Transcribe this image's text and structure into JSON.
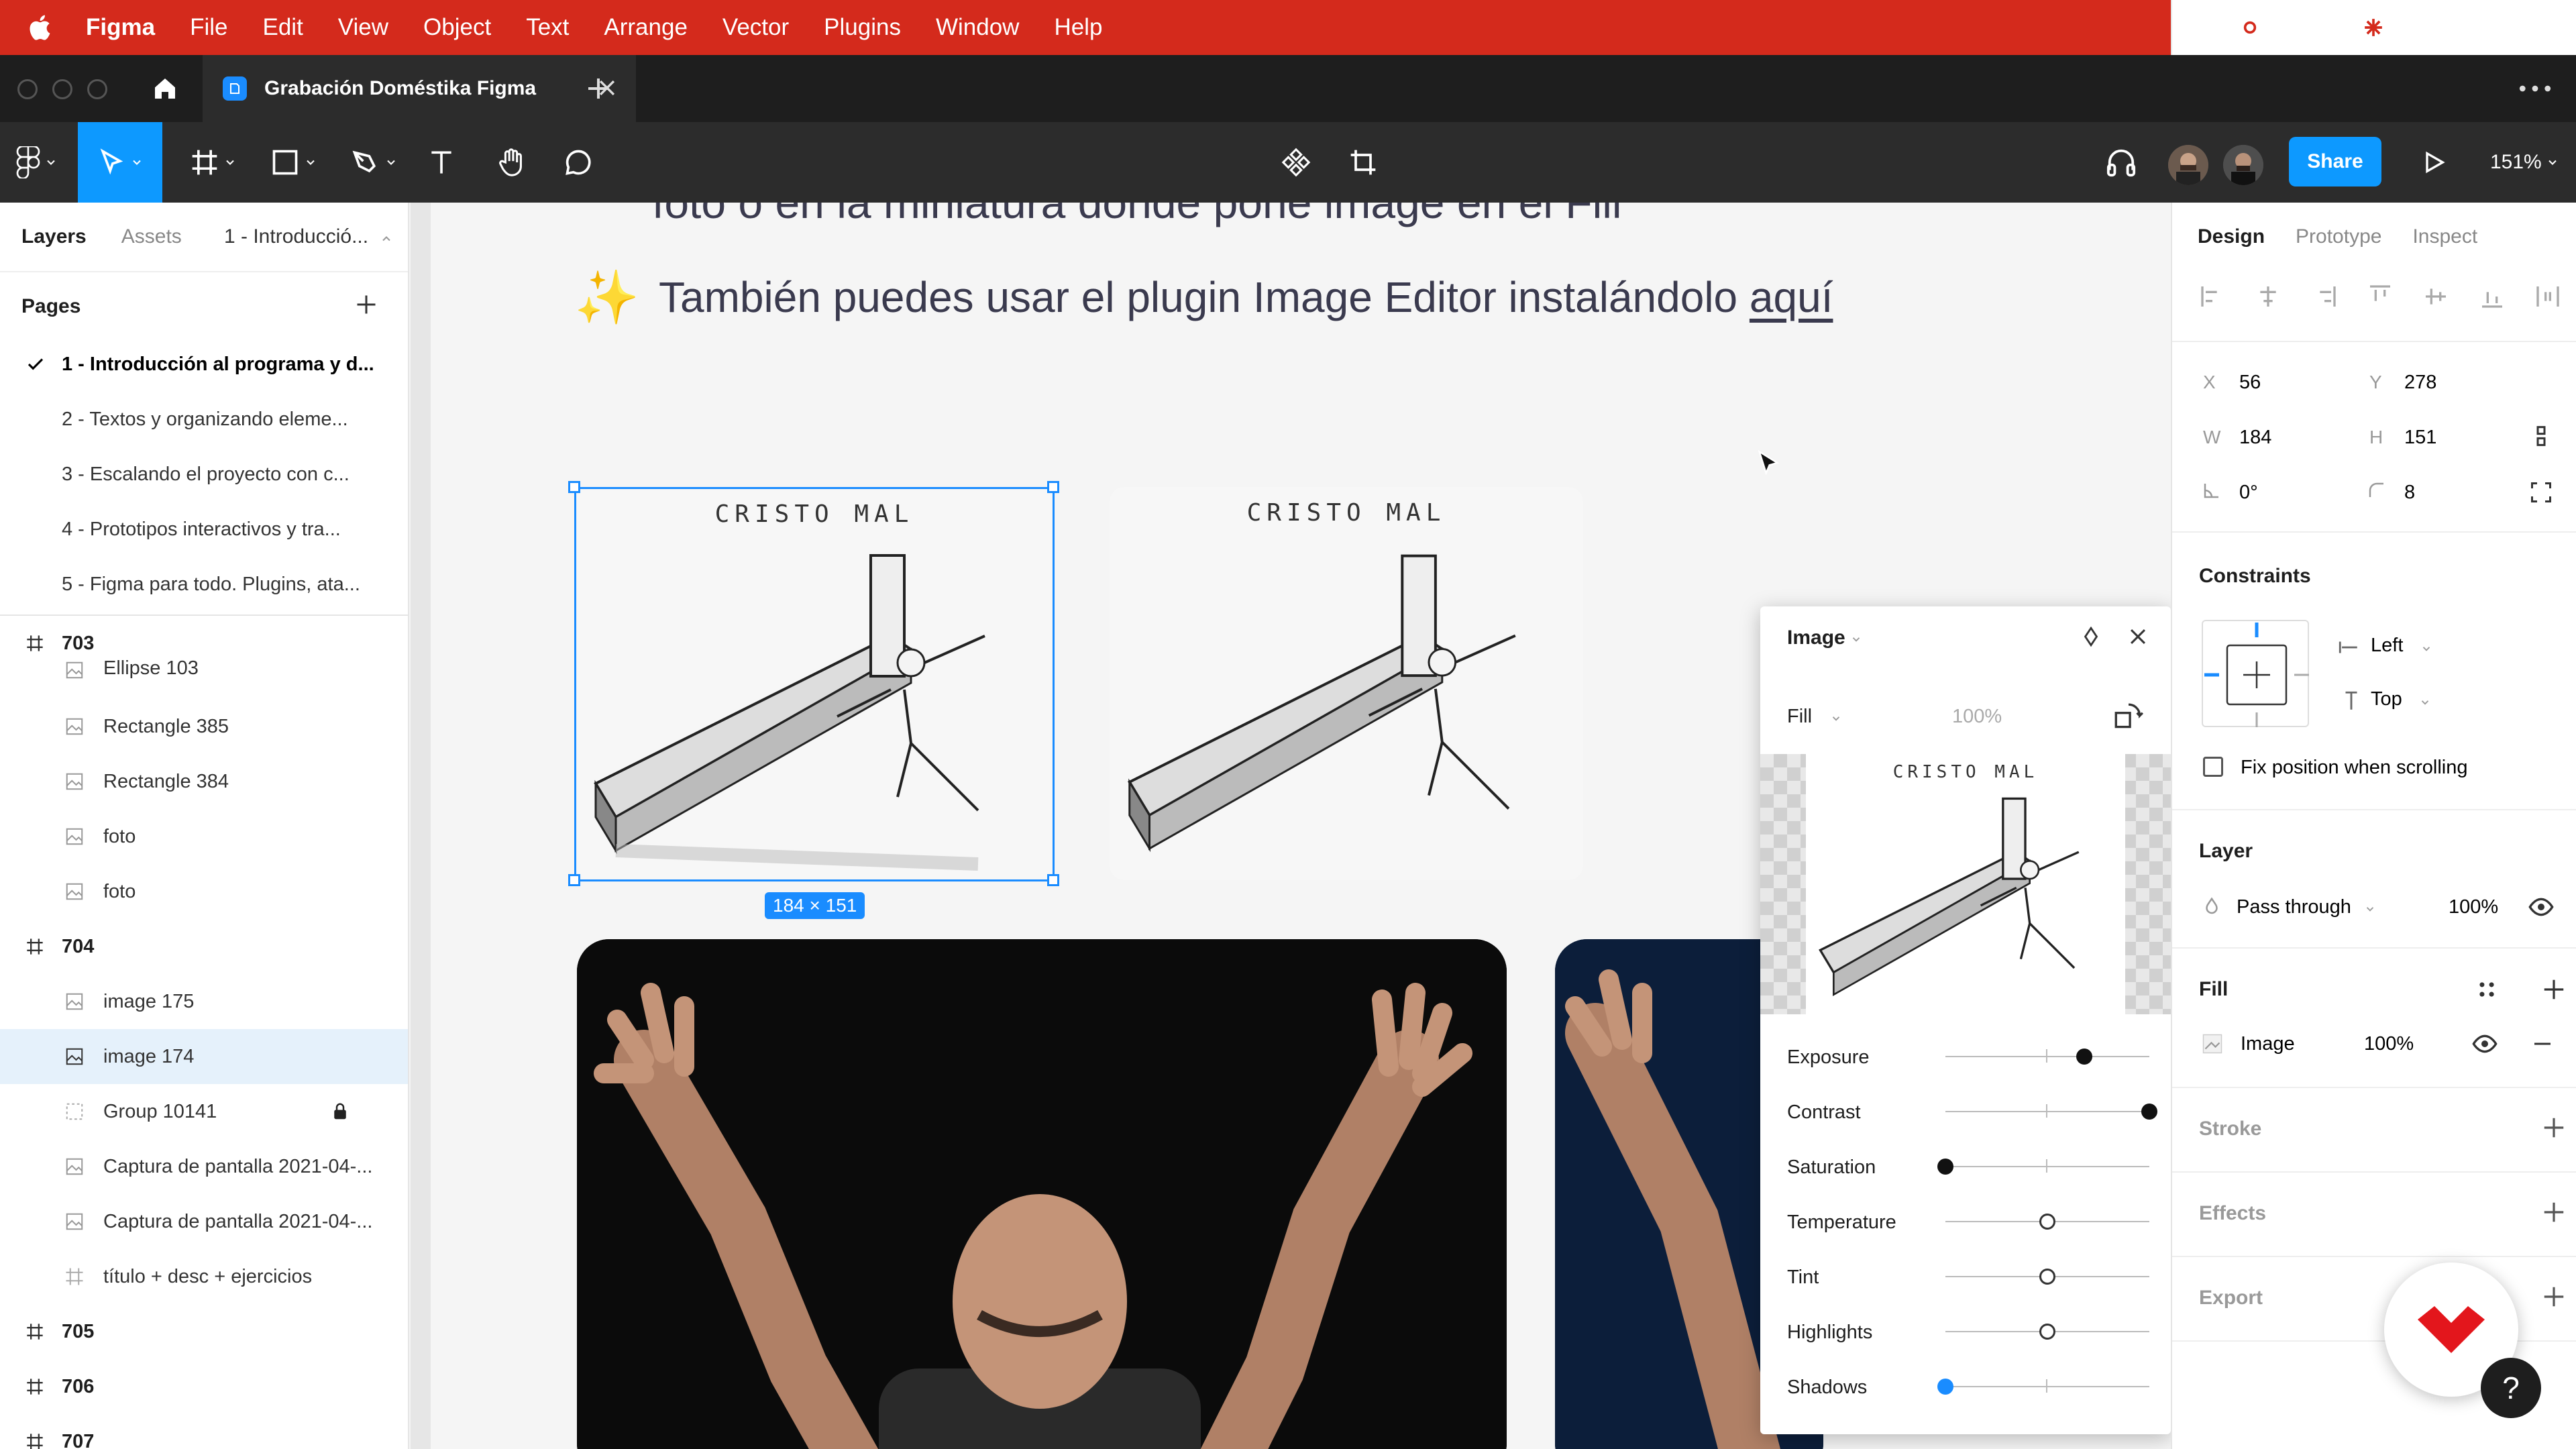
{
  "menubar": {
    "app": "Figma",
    "items": [
      "File",
      "Edit",
      "View",
      "Object",
      "Text",
      "Arrange",
      "Vector",
      "Plugins",
      "Window",
      "Help"
    ],
    "right_icons": [
      "creative-cloud-icon",
      "app-icon",
      "plus-cross-icon",
      "snowflake-icon",
      "search-icon",
      "control-center-icon",
      "clock-icon"
    ]
  },
  "tabbar": {
    "file_title": "Grabación Doméstika Figma"
  },
  "toolbar": {
    "share_label": "Share",
    "zoom": "151%"
  },
  "left": {
    "tab_layers": "Layers",
    "tab_assets": "Assets",
    "page_selector": "1 - Introducció...",
    "pages_heading": "Pages",
    "pages": [
      {
        "label": "1 - Introducción al programa y d...",
        "current": true
      },
      {
        "label": "2 - Textos y organizando eleme...",
        "current": false
      },
      {
        "label": "3 - Escalando el proyecto con c...",
        "current": false
      },
      {
        "label": "4 - Prototipos interactivos y tra...",
        "current": false
      },
      {
        "label": "5 - Figma para todo. Plugins, ata...",
        "current": false
      }
    ],
    "layers": [
      {
        "label": "703",
        "kind": "frame"
      },
      {
        "label": "Ellipse 103",
        "kind": "image"
      },
      {
        "label": "Rectangle 385",
        "kind": "image"
      },
      {
        "label": "Rectangle 384",
        "kind": "image"
      },
      {
        "label": "foto",
        "kind": "image"
      },
      {
        "label": "foto",
        "kind": "image"
      },
      {
        "label": "704",
        "kind": "frame"
      },
      {
        "label": "image 175",
        "kind": "image"
      },
      {
        "label": "image 174",
        "kind": "image",
        "selected": true
      },
      {
        "label": "Group 10141",
        "kind": "group",
        "locked": true
      },
      {
        "label": "Captura de pantalla 2021-04-...",
        "kind": "image"
      },
      {
        "label": "Captura de pantalla 2021-04-...",
        "kind": "image"
      },
      {
        "label": "título + desc + ejercicios",
        "kind": "frame-child"
      },
      {
        "label": "705",
        "kind": "frame"
      },
      {
        "label": "706",
        "kind": "frame"
      },
      {
        "label": "707",
        "kind": "frame"
      }
    ]
  },
  "canvas": {
    "top_text": "foto o en la miniatura donde pone image en el Fill",
    "line_prefix": "También puedes usar el plugin Image Editor instalándolo ",
    "line_link": "aquí",
    "sketch_caption": "CRISTO MAL",
    "size_badge": "184 × 151"
  },
  "image_panel": {
    "title": "Image",
    "fill_mode": "Fill",
    "opacity": "100%",
    "preview_caption": "CRISTO MAL",
    "sliders": [
      {
        "label": "Exposure",
        "value": 0.68,
        "style": "filled"
      },
      {
        "label": "Contrast",
        "value": 1.0,
        "style": "filled"
      },
      {
        "label": "Saturation",
        "value": 0.0,
        "style": "filled"
      },
      {
        "label": "Temperature",
        "value": 0.5,
        "style": "hollow"
      },
      {
        "label": "Tint",
        "value": 0.5,
        "style": "hollow"
      },
      {
        "label": "Highlights",
        "value": 0.5,
        "style": "hollow"
      },
      {
        "label": "Shadows",
        "value": 0.0,
        "style": "blue"
      }
    ]
  },
  "design": {
    "tab_design": "Design",
    "tab_prototype": "Prototype",
    "tab_inspect": "Inspect",
    "x_label": "X",
    "x": "56",
    "y_label": "Y",
    "y": "278",
    "w_label": "W",
    "w": "184",
    "h_label": "H",
    "h": "151",
    "rotation": "0°",
    "radius": "8",
    "constraints_title": "Constraints",
    "constraint_h": "Left",
    "constraint_v": "Top",
    "fix_position": "Fix position when scrolling",
    "layer_title": "Layer",
    "blend": "Pass through",
    "layer_opacity": "100%",
    "fill_title": "Fill",
    "fill_type": "Image",
    "fill_opacity": "100%",
    "stroke_title": "Stroke",
    "effects_title": "Effects",
    "export_title": "Export",
    "help": "?"
  },
  "colors": {
    "menubar": "#d42a1c",
    "accent": "#0d99ff",
    "toolbar": "#2c2c2c",
    "brand_logo": "#e3161c"
  }
}
